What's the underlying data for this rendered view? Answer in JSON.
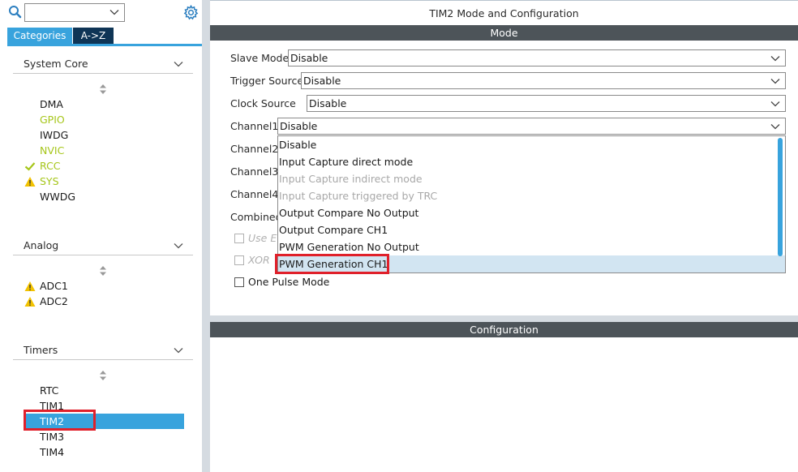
{
  "left": {
    "tabs": {
      "categories": "Categories",
      "az": "A->Z"
    },
    "sections": {
      "system_core": {
        "title": "System Core",
        "items": [
          {
            "label": "DMA",
            "state": "normal"
          },
          {
            "label": "GPIO",
            "state": "green"
          },
          {
            "label": "IWDG",
            "state": "normal"
          },
          {
            "label": "NVIC",
            "state": "green"
          },
          {
            "label": "RCC",
            "state": "green-check"
          },
          {
            "label": "SYS",
            "state": "green-warning"
          },
          {
            "label": "WWDG",
            "state": "normal"
          }
        ]
      },
      "analog": {
        "title": "Analog",
        "items": [
          {
            "label": "ADC1",
            "state": "warning"
          },
          {
            "label": "ADC2",
            "state": "warning"
          }
        ]
      },
      "timers": {
        "title": "Timers",
        "items": [
          {
            "label": "RTC",
            "state": "normal"
          },
          {
            "label": "TIM1",
            "state": "normal"
          },
          {
            "label": "TIM2",
            "state": "selected"
          },
          {
            "label": "TIM3",
            "state": "normal"
          },
          {
            "label": "TIM4",
            "state": "normal"
          }
        ]
      }
    }
  },
  "right": {
    "title": "TIM2 Mode and Configuration",
    "mode_bar": "Mode",
    "config_bar": "Configuration",
    "rows": {
      "slave_mode": {
        "label": "Slave Mode",
        "value": "Disable"
      },
      "trigger_source": {
        "label": "Trigger Source",
        "value": "Disable"
      },
      "clock_source": {
        "label": "Clock Source",
        "value": "Disable"
      },
      "channel1": {
        "label": "Channel1",
        "value": "Disable"
      },
      "channel2": {
        "label": "Channel2"
      },
      "channel3": {
        "label": "Channel3"
      },
      "channel4": {
        "label": "Channel4"
      },
      "combined": {
        "label": "Combined"
      }
    },
    "checks": {
      "use_e": "Use E",
      "xor": "XOR",
      "one_pulse": "One Pulse Mode"
    },
    "dropdown_options": [
      {
        "label": "Disable",
        "disabled": false
      },
      {
        "label": "Input Capture direct mode",
        "disabled": false
      },
      {
        "label": "Input Capture indirect mode",
        "disabled": true
      },
      {
        "label": "Input Capture triggered by TRC",
        "disabled": true
      },
      {
        "label": "Output Compare No Output",
        "disabled": false
      },
      {
        "label": "Output Compare CH1",
        "disabled": false
      },
      {
        "label": "PWM Generation No Output",
        "disabled": false
      },
      {
        "label": "PWM Generation CH1",
        "disabled": false,
        "selected": true
      }
    ]
  },
  "colors": {
    "accent": "#38a3dd",
    "dark_tab": "#0f3556",
    "bar": "#4d5459",
    "green": "#a6c61a",
    "warning": "#f2c200",
    "highlight": "#e0202a"
  }
}
